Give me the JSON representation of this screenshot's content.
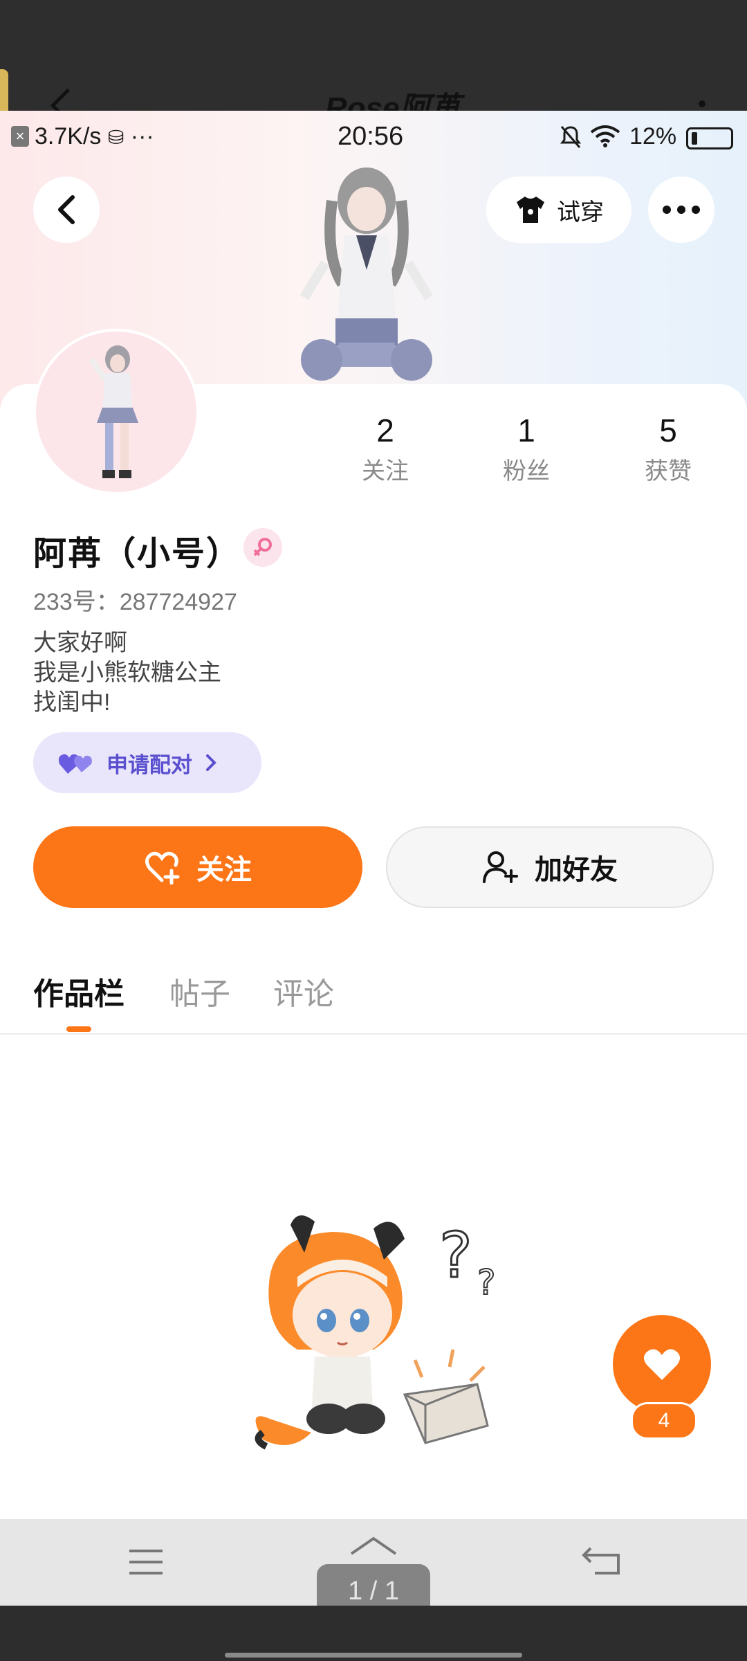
{
  "background_app": {
    "title": "Rose阿苒"
  },
  "status_bar": {
    "speed": "3.7K/s",
    "time": "20:56",
    "battery_percent": "12%"
  },
  "header": {
    "tryon_label": "试穿"
  },
  "profile": {
    "stats": [
      {
        "value": "2",
        "label": "关注"
      },
      {
        "value": "1",
        "label": "粉丝"
      },
      {
        "value": "5",
        "label": "获赞"
      }
    ],
    "nickname": "阿苒（小号）",
    "uid": "233号：287724927",
    "bio": [
      "大家好啊",
      "我是小熊软糖公主",
      "找闺中!"
    ],
    "pair_button_label": "申请配对"
  },
  "actions": {
    "follow_label": "关注",
    "add_friend_label": "加好友"
  },
  "tabs": [
    {
      "label": "作品栏",
      "active": true
    },
    {
      "label": "帖子",
      "active": false
    },
    {
      "label": "评论",
      "active": false
    }
  ],
  "like_fab": {
    "count": "4"
  },
  "page_indicator": "1 / 1",
  "colors": {
    "accent": "#fc7516",
    "pair_purple": "#5a4fcf"
  }
}
